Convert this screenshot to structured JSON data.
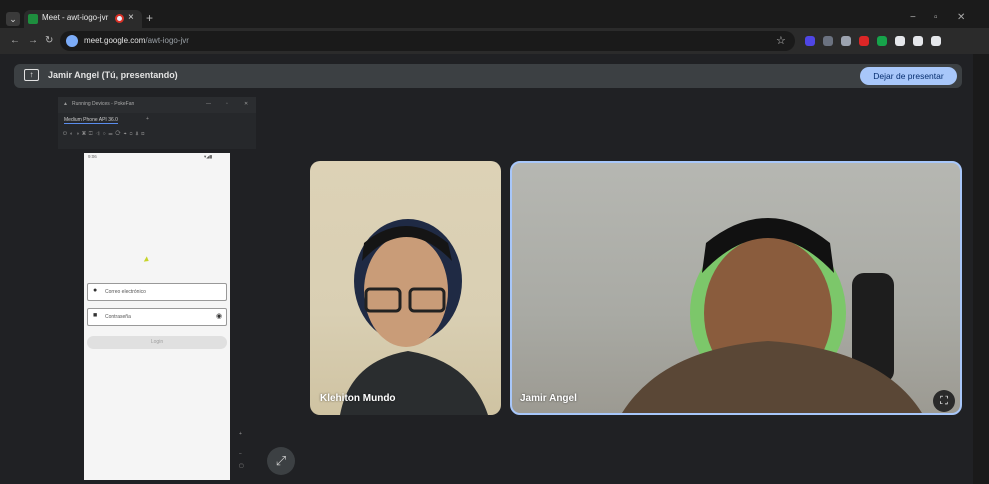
{
  "browser": {
    "tab_title": "Meet - awt-iogo-jvr",
    "tab_close": "×",
    "new_tab": "+",
    "window_controls": [
      "−",
      "▫",
      "✕"
    ],
    "nav": {
      "back": "←",
      "forward": "→",
      "reload": "↻"
    },
    "url_host": "meet.google.com",
    "url_path": "/awt-iogo-jvr",
    "bookmark": "☆",
    "extension_colors": [
      "#4f46e5",
      "#6b7280",
      "#9ca3af",
      "#dc2626",
      "#16a34a",
      "#e5e7eb",
      "#e5e7eb",
      "#e5e7eb"
    ]
  },
  "meet": {
    "presenting_text": "Jamir Angel (Tú, presentando)",
    "stop_presenting": "Dejar de presentar",
    "tiles": [
      {
        "name": "Klehiton Mundo"
      },
      {
        "name": "Jamir Angel"
      }
    ]
  },
  "shared_screen": {
    "window_title": "Running Devices - PokeFan",
    "device_tab": "Medium Phone API 36.0",
    "status_time": "9:06",
    "status_icons": "▾◢▮",
    "email_placeholder": "Correo electrónico",
    "password_placeholder": "Contraseña",
    "login_button": "Login",
    "user_icon": "👤",
    "lock_icon": "🔒",
    "eye_icon": "◉"
  },
  "icons": {
    "expand": "⤢",
    "crop": "⛶"
  }
}
